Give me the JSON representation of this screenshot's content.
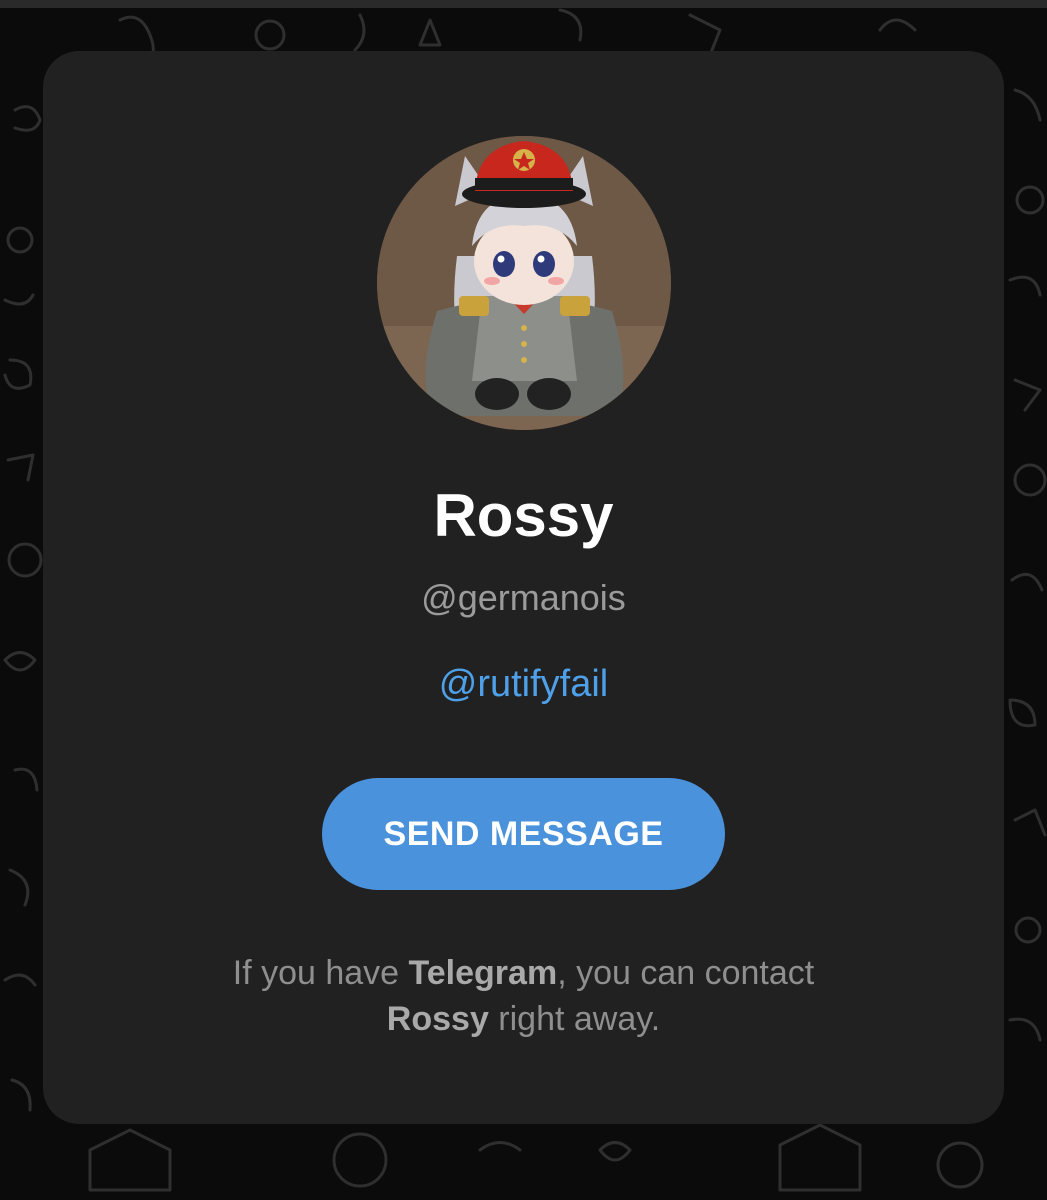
{
  "profile": {
    "name": "Rossy",
    "username": "@germanois",
    "link": "@rutifyfail",
    "avatar_icon": "avatar-image"
  },
  "actions": {
    "send_label": "SEND MESSAGE"
  },
  "info": {
    "part1": "If you have ",
    "app_name": "Telegram",
    "part2": ", you can contact",
    "contact_name": "Rossy",
    "part3": " right away."
  },
  "colors": {
    "background": "#0b0b0b",
    "card": "#212121",
    "accent": "#4a92dc",
    "link": "#4ea0e8",
    "muted_text": "#9b9b9b"
  }
}
